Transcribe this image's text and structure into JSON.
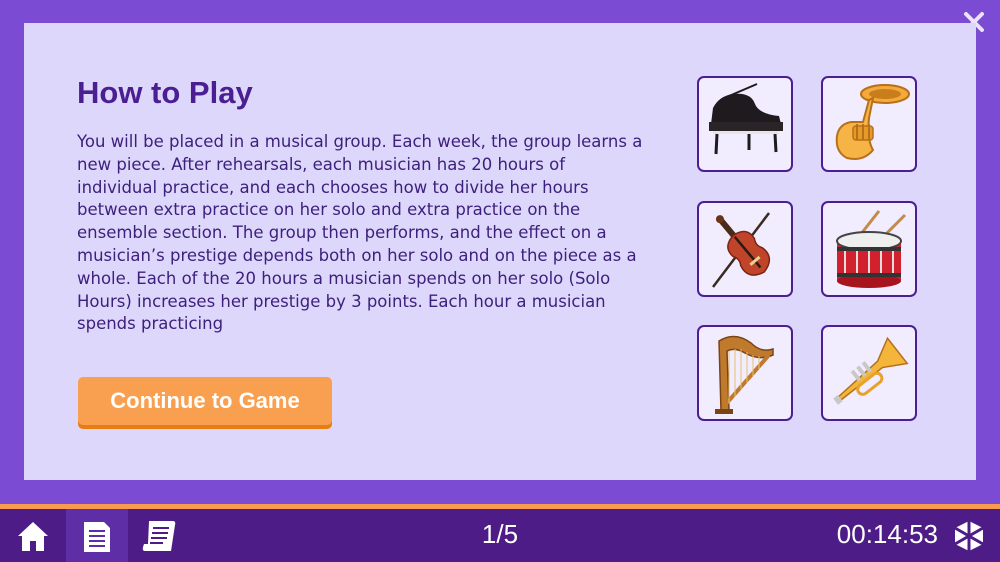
{
  "dialog": {
    "title": "How to Play",
    "body": "You will be placed in a musical group. Each week, the group learns a new piece. After rehearsals, each musician has 20 hours of individual practice, and each chooses how to divide her hours between extra practice on her solo and extra practice on the ensemble section. The group then performs, and the effect on a musician’s prestige depends both on her solo and on the piece as a whole. Each of the 20 hours a musician spends on her solo (Solo Hours) increases her prestige by 3 points. Each hour a musician spends practicing",
    "continue_label": "Continue to Game",
    "close_icon": "close-icon"
  },
  "instruments": [
    {
      "name": "piano",
      "icon": "piano-icon"
    },
    {
      "name": "tuba",
      "icon": "tuba-icon"
    },
    {
      "name": "violin",
      "icon": "violin-icon"
    },
    {
      "name": "drum",
      "icon": "drum-icon"
    },
    {
      "name": "harp",
      "icon": "harp-icon"
    },
    {
      "name": "trumpet",
      "icon": "trumpet-icon"
    }
  ],
  "bottom_bar": {
    "nav": [
      {
        "icon": "home-icon",
        "active": false
      },
      {
        "icon": "document-icon",
        "active": true
      },
      {
        "icon": "scroll-icon",
        "active": false
      }
    ],
    "page_indicator": "1/5",
    "timer": "00:14:53",
    "logo_icon": "cube-logo-icon"
  },
  "colors": {
    "frame": "#7c4bd4",
    "panel": "#ddd7fb",
    "title": "#4b1f92",
    "button": "#f9a050",
    "bottom_bar": "#4d1c87",
    "accent_divider": "#f89a4f"
  }
}
